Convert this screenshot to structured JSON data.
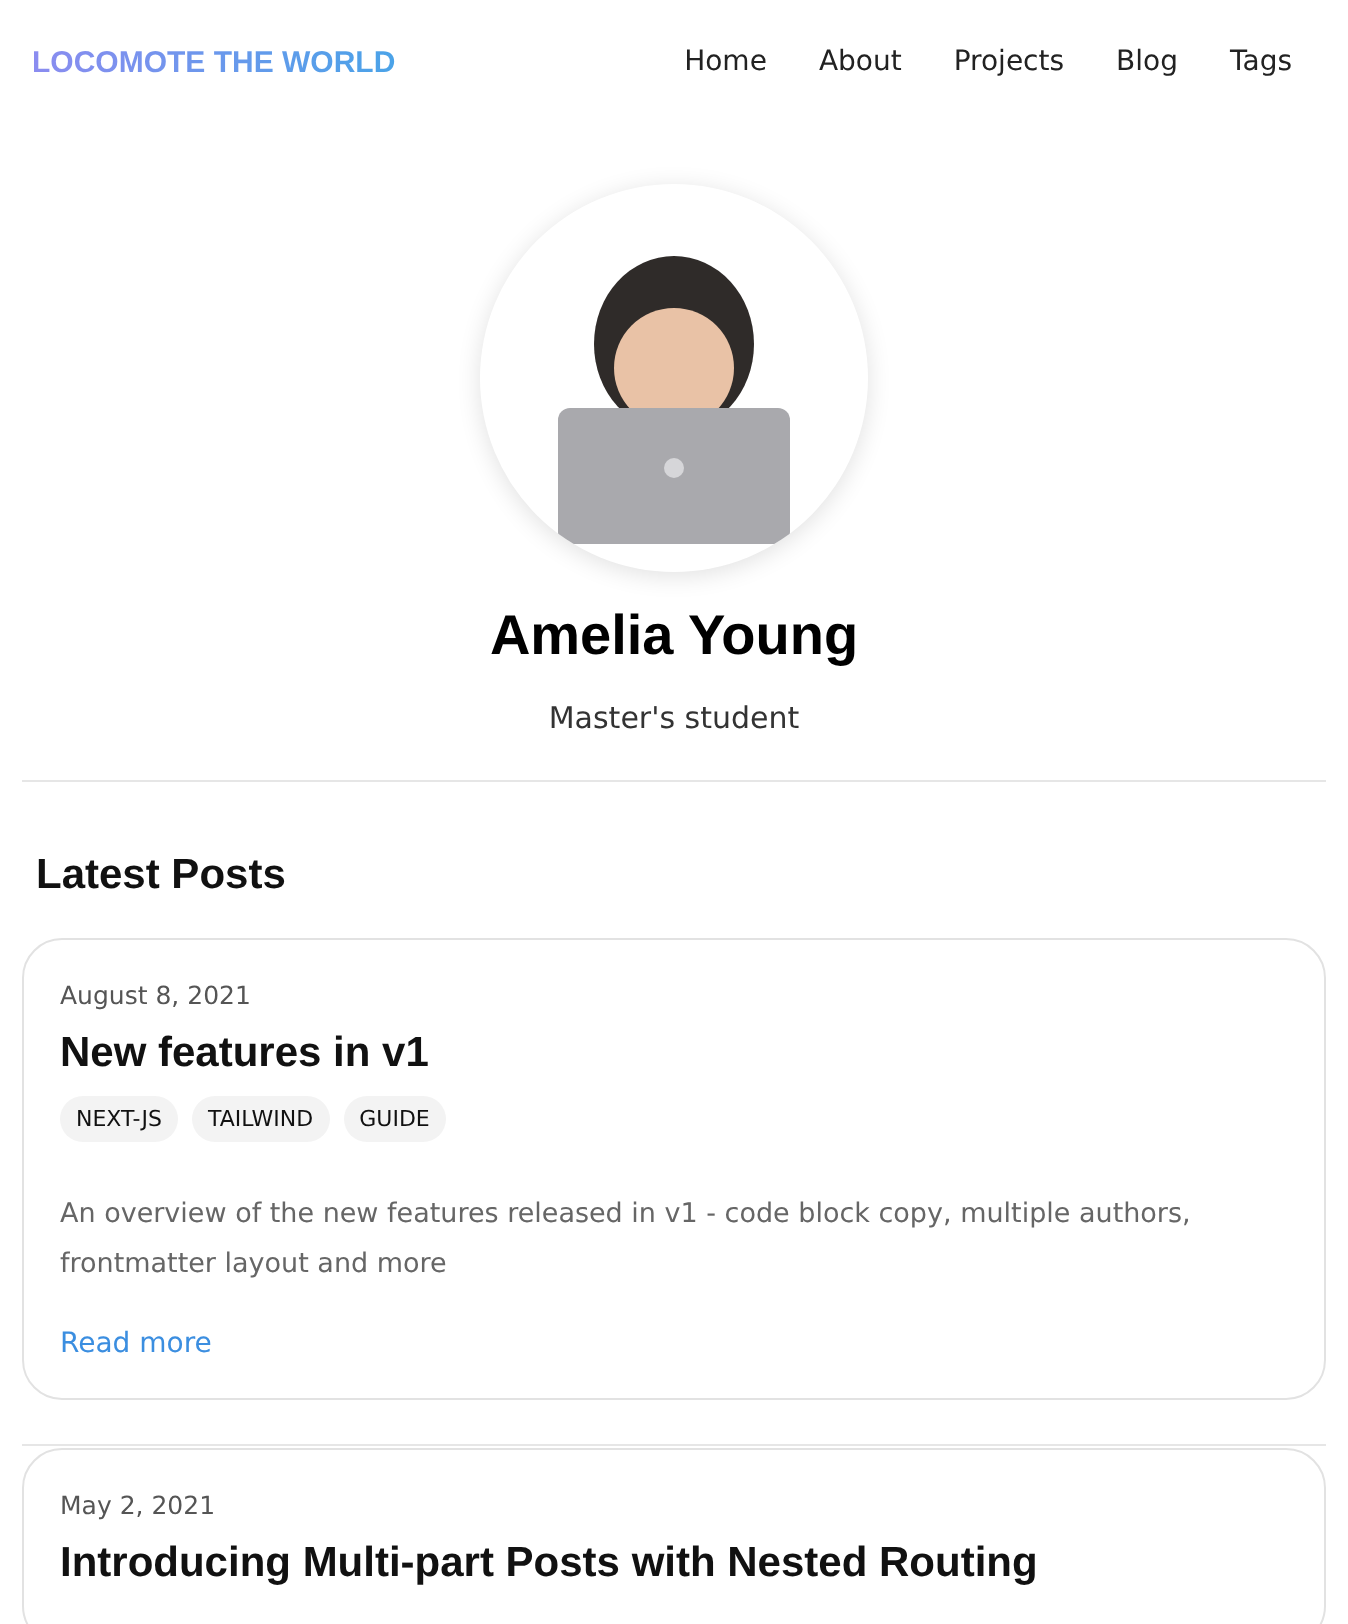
{
  "site_title": "LOCOMOTE THE WORLD",
  "nav": [
    {
      "label": "Home"
    },
    {
      "label": "About"
    },
    {
      "label": "Projects"
    },
    {
      "label": "Blog"
    },
    {
      "label": "Tags"
    }
  ],
  "profile": {
    "name": "Amelia Young",
    "role": "Master's student"
  },
  "section_title": "Latest Posts",
  "posts": [
    {
      "date": "August 8, 2021",
      "title": "New features in v1",
      "tags": [
        "NEXT-JS",
        "TAILWIND",
        "GUIDE"
      ],
      "summary": "An overview of the new features released in v1 - code block copy, multiple authors, frontmatter layout and more",
      "link": "Read more"
    },
    {
      "date": "May 2, 2021",
      "title": "Introducing Multi-part Posts with Nested Routing"
    }
  ]
}
